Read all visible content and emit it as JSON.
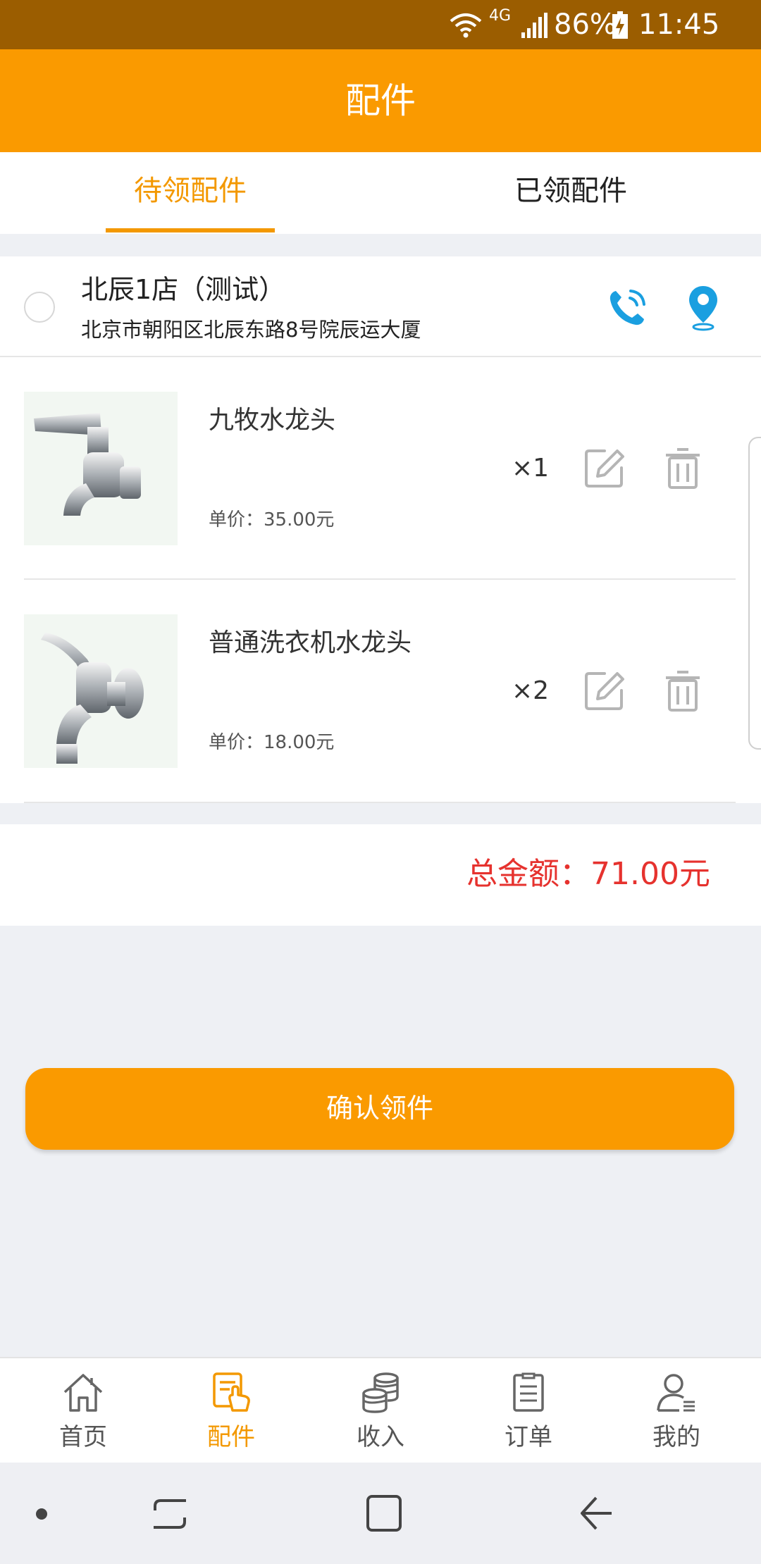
{
  "status_bar": {
    "signal": "4G",
    "battery": "86%",
    "time": "11:45"
  },
  "header": {
    "title": "配件"
  },
  "tabs": [
    {
      "label": "待领配件",
      "active": true
    },
    {
      "label": "已领配件",
      "active": false
    }
  ],
  "store": {
    "name": "北辰1店（测试）",
    "address": "北京市朝阳区北辰东路8号院辰运大厦",
    "phone_icon": "phone-icon",
    "location_icon": "location-pin-icon"
  },
  "items": [
    {
      "name": "九牧水龙头",
      "price": "单价：35.00元",
      "qty": "×1"
    },
    {
      "name": "普通洗衣机水龙头",
      "price": "单价：18.00元",
      "qty": "×2"
    }
  ],
  "total": {
    "text": "总金额：71.00元"
  },
  "confirm": {
    "label": "确认领件"
  },
  "bottom_nav": [
    {
      "label": "首页",
      "icon": "home-icon",
      "active": false
    },
    {
      "label": "配件",
      "icon": "parts-icon",
      "active": true
    },
    {
      "label": "收入",
      "icon": "coins-icon",
      "active": false
    },
    {
      "label": "订单",
      "icon": "order-icon",
      "active": false
    },
    {
      "label": "我的",
      "icon": "profile-icon",
      "active": false
    }
  ],
  "colors": {
    "accent": "#fa9a00",
    "status_bar": "#9b5d00",
    "total_text": "#e6322e",
    "icon_blue": "#1a9fe0"
  }
}
